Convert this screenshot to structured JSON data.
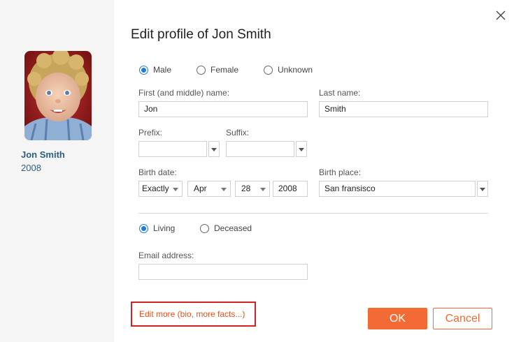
{
  "sidebar": {
    "name": "Jon Smith",
    "year": "2008"
  },
  "dialog": {
    "title": "Edit profile of Jon Smith",
    "close_icon": "close-icon"
  },
  "gender": {
    "options": [
      {
        "label": "Male",
        "checked": true
      },
      {
        "label": "Female",
        "checked": false
      },
      {
        "label": "Unknown",
        "checked": false
      }
    ]
  },
  "fields": {
    "first_name_label": "First (and middle) name:",
    "first_name_value": "Jon",
    "last_name_label": "Last name:",
    "last_name_value": "Smith",
    "prefix_label": "Prefix:",
    "prefix_value": "",
    "suffix_label": "Suffix:",
    "suffix_value": "",
    "birth_date_label": "Birth date:",
    "birth_qualifier": "Exactly",
    "birth_month": "Apr",
    "birth_day": "28",
    "birth_year": "2008",
    "birth_place_label": "Birth place:",
    "birth_place_value": "San fransisco",
    "email_label": "Email address:",
    "email_value": ""
  },
  "living_status": {
    "options": [
      {
        "label": "Living",
        "checked": true
      },
      {
        "label": "Deceased",
        "checked": false
      }
    ]
  },
  "footer": {
    "edit_more": "Edit more (bio, more facts...)",
    "ok": "OK",
    "cancel": "Cancel"
  },
  "colors": {
    "accent": "#f36a34",
    "radio": "#1f7dd6",
    "name": "#2a5f82",
    "highlight_border": "#d42020"
  }
}
